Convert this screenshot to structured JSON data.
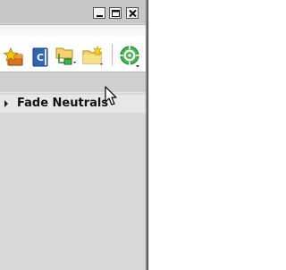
{
  "window": {
    "buttons": [
      {
        "name": "minimize",
        "symbol": "_"
      },
      {
        "name": "maximize",
        "symbol": "□"
      },
      {
        "name": "close",
        "symbol": "×"
      }
    ]
  },
  "toolbar": {
    "icons": [
      "star-folder-icon",
      "contacts-book-icon",
      "folder-tree-icon",
      "new-folder-icon",
      "target-settings-icon"
    ]
  },
  "tree": {
    "group_label": "Fade Neutrals"
  },
  "colors": {
    "panel_bg": "#d8d8d8",
    "toolbar_bg": "#ffffff",
    "group_row_bg": "#e7e7e7",
    "accent_green": "#3cb84a"
  }
}
